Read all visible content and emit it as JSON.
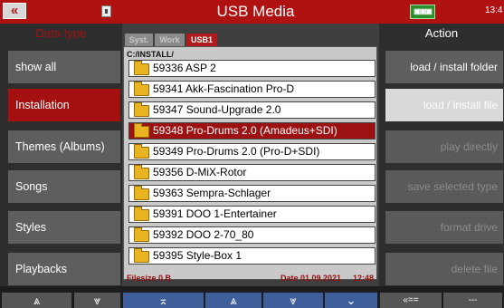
{
  "title_bar": {
    "back_label": "«",
    "title": "USB Media",
    "network_label": "▣▣▣",
    "clock": "13:4"
  },
  "left_panel": {
    "heading": "Data type",
    "items": [
      {
        "label": "show all"
      },
      {
        "label": "Installation",
        "selected": true
      },
      {
        "label": "Themes (Albums)"
      },
      {
        "label": "Songs"
      },
      {
        "label": "Styles"
      },
      {
        "label": "Playbacks"
      }
    ]
  },
  "tabs": [
    {
      "label": "Syst."
    },
    {
      "label": "Work"
    },
    {
      "label": "USB1",
      "active": true
    }
  ],
  "file_list": {
    "path": "C:/INSTALL/",
    "rows": [
      {
        "label": "59336 ASP 2"
      },
      {
        "label": "59341 Akk-Fascination Pro-D"
      },
      {
        "label": "59347 Sound-Upgrade 2.0"
      },
      {
        "label": "59348 Pro-Drums 2.0 (Amadeus+SDI)",
        "selected": true
      },
      {
        "label": "59349 Pro-Drums 2.0 (Pro-D+SDI)"
      },
      {
        "label": "59356 D-MiX-Rotor"
      },
      {
        "label": "59363 Sempra-Schlager"
      },
      {
        "label": "59391 DOO 1-Entertainer"
      },
      {
        "label": "59392 DOO 2-70_80"
      },
      {
        "label": "59395 Style-Box 1"
      }
    ],
    "filesize": "Filesize 0 B",
    "date": "Date 01.09.2021",
    "time": "12:48"
  },
  "right_panel": {
    "heading": "Action",
    "items": [
      {
        "label": "load  /  install folder"
      },
      {
        "label": "load  /  install file"
      },
      {
        "label": "play directly"
      },
      {
        "label": "save selected type"
      },
      {
        "label": "format drive"
      },
      {
        "label": "delete file"
      }
    ]
  },
  "bottom_nav": [
    "⩓",
    "⩔",
    "⌅",
    "⩓",
    "⩔",
    "⌄",
    "«==",
    "---"
  ],
  "colors": {
    "accent_red": "#b01212",
    "selected_red": "#9c1111",
    "nav_blue": "#3f5f9a"
  }
}
